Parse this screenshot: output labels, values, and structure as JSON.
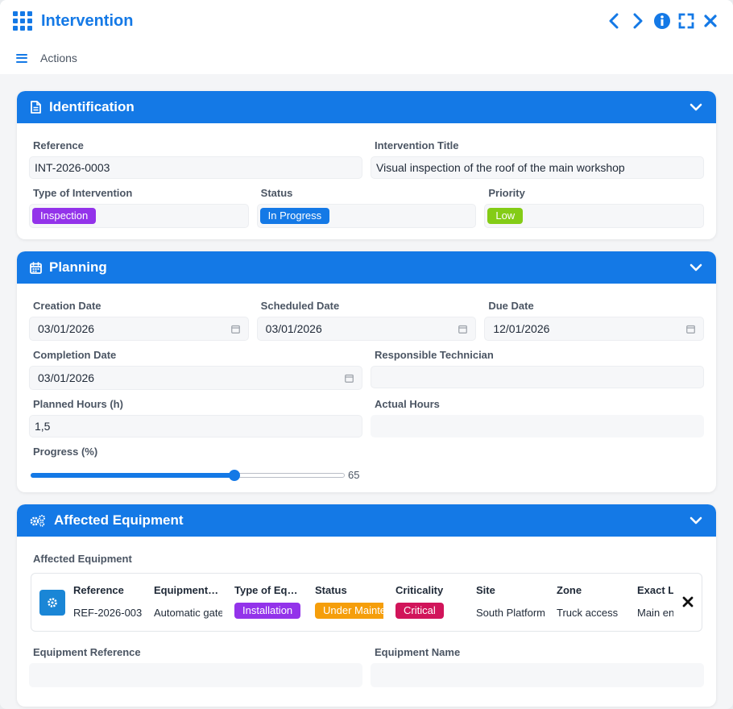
{
  "window": {
    "title": "Intervention",
    "actions_label": "Actions"
  },
  "identification": {
    "title": "Identification",
    "reference_label": "Reference",
    "reference_value": "INT-2026-0003",
    "intervention_title_label": "Intervention Title",
    "intervention_title_value": "Visual inspection of the roof of the main workshop",
    "type_label": "Type of Intervention",
    "type_value": "Inspection",
    "status_label": "Status",
    "status_value": "In Progress",
    "priority_label": "Priority",
    "priority_value": "Low"
  },
  "planning": {
    "title": "Planning",
    "creation_date_label": "Creation Date",
    "creation_date_value": "03/01/2026",
    "scheduled_date_label": "Scheduled Date",
    "scheduled_date_value": "03/01/2026",
    "due_date_label": "Due Date",
    "due_date_value": "12/01/2026",
    "completion_date_label": "Completion Date",
    "completion_date_value": "03/01/2026",
    "technician_label": "Responsible Technician",
    "technician_value": "",
    "planned_hours_label": "Planned Hours (h)",
    "planned_hours_value": "1,5",
    "actual_hours_label": "Actual Hours",
    "actual_hours_value": "",
    "progress_label": "Progress (%)",
    "progress_value": "65",
    "progress_percent": 65
  },
  "equipment": {
    "title": "Affected Equipment",
    "list_label": "Affected Equipment",
    "headers": [
      "Reference",
      "Equipment…",
      "Type of Eq…",
      "Status",
      "Criticality",
      "Site",
      "Zone",
      "Exact L"
    ],
    "row": {
      "reference": "REF-2026-003",
      "equipment": "Automatic gate",
      "type": "Installation",
      "status": "Under Maintenance",
      "criticality": "Critical",
      "site": "South Platform",
      "zone": "Truck access",
      "exact_location": "Main entrance"
    },
    "equipment_reference_label": "Equipment Reference",
    "equipment_name_label": "Equipment Name"
  },
  "colors": {
    "accent": "#1479e6",
    "badge_inspection": "#9333ea",
    "badge_in_progress": "#1479e6",
    "badge_low": "#84cc16",
    "badge_installation": "#9333ea",
    "badge_under_maintenance": "#f59e0b",
    "badge_critical": "#d1145a"
  },
  "icons": {
    "title": "grid-icon",
    "prev": "chevron-left-icon",
    "next": "chevron-right-icon",
    "info": "info-icon",
    "expand": "expand-icon",
    "close": "close-icon",
    "menu": "hamburger-icon",
    "identification": "document-icon",
    "planning": "calendar-icon",
    "equipment": "gears-icon",
    "collapse": "chevron-down-icon",
    "date": "calendar-small-icon",
    "equipment_row": "gear-icon",
    "remove": "remove-icon"
  }
}
